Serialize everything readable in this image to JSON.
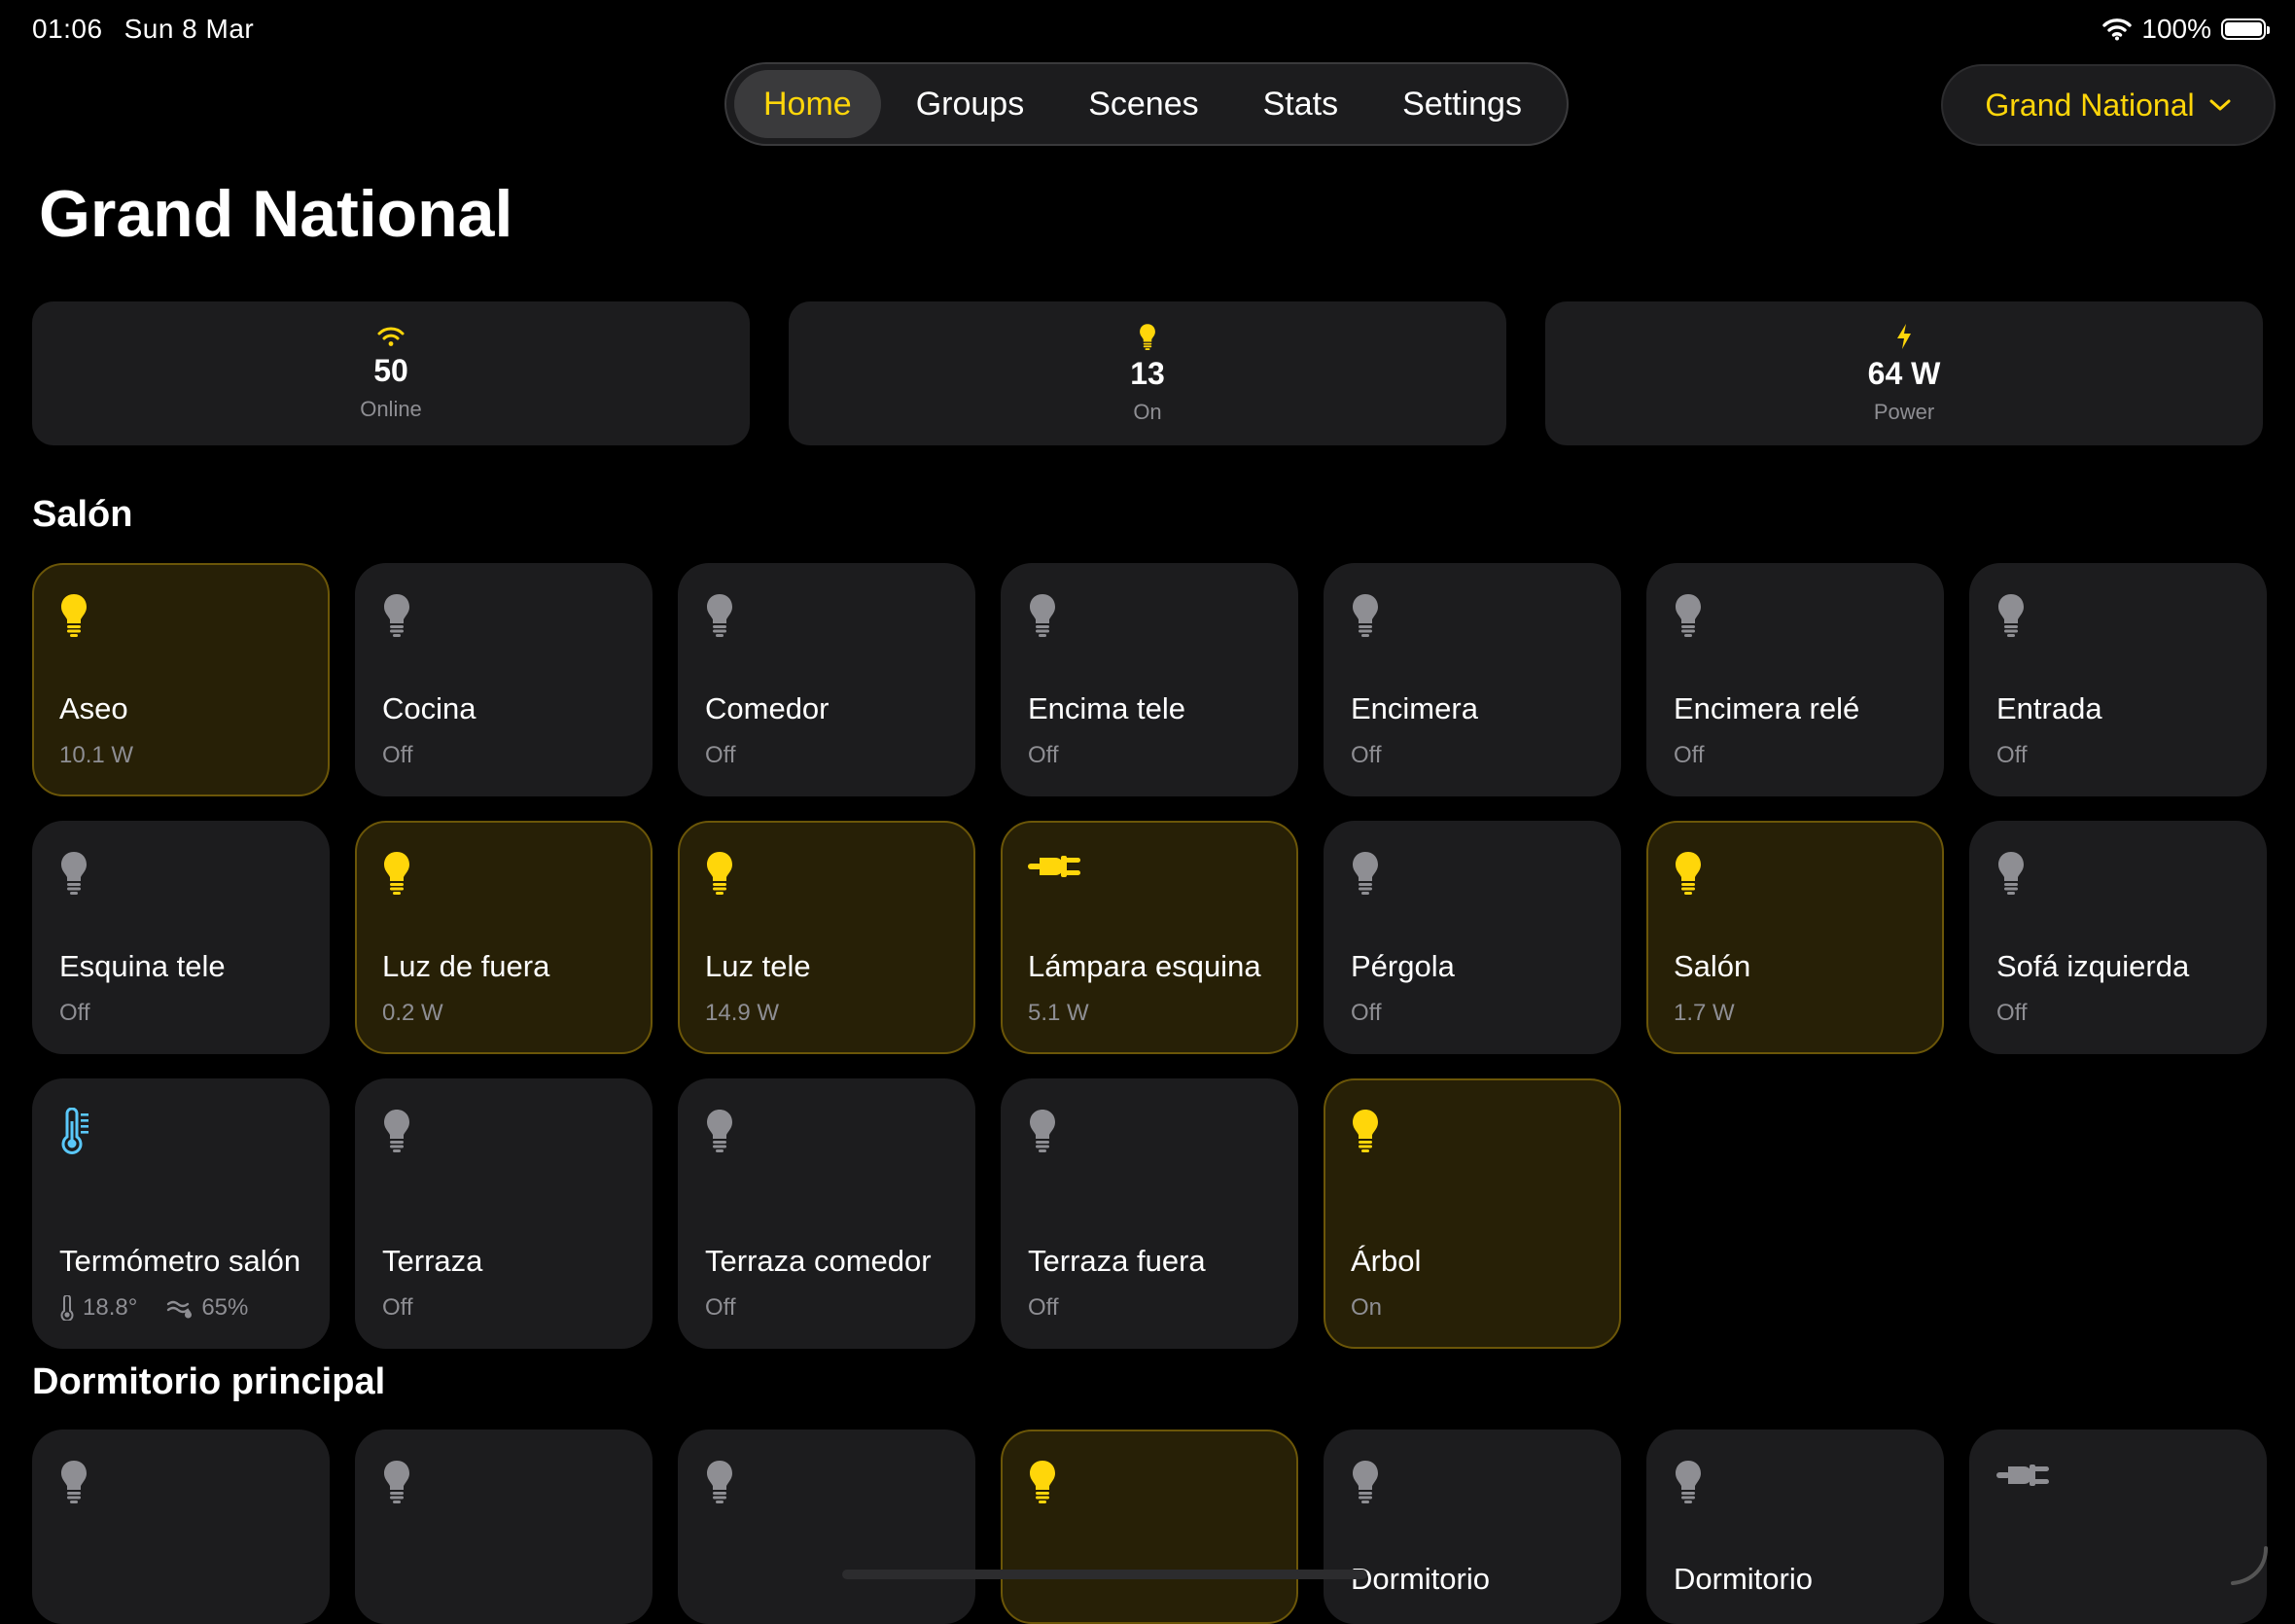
{
  "status": {
    "time": "01:06",
    "date": "Sun 8 Mar",
    "battery": "100%"
  },
  "nav": {
    "tabs": [
      {
        "label": "Home",
        "active": true
      },
      {
        "label": "Groups"
      },
      {
        "label": "Scenes"
      },
      {
        "label": "Stats"
      },
      {
        "label": "Settings"
      }
    ]
  },
  "location": {
    "label": "Grand National"
  },
  "page_title": "Grand National",
  "summary": [
    {
      "icon": "wifi-icon",
      "value": "50",
      "label": "Online"
    },
    {
      "icon": "bulb-icon",
      "value": "13",
      "label": "On"
    },
    {
      "icon": "bolt-icon",
      "value": "64 W",
      "label": "Power"
    }
  ],
  "sections": [
    {
      "title": "Salón",
      "devices": [
        {
          "name": "Aseo",
          "status": "10.1 W",
          "on": true,
          "icon": "bulb-icon"
        },
        {
          "name": "Cocina",
          "status": "Off",
          "on": false,
          "icon": "bulb-icon"
        },
        {
          "name": "Comedor",
          "status": "Off",
          "on": false,
          "icon": "bulb-icon"
        },
        {
          "name": "Encima tele",
          "status": "Off",
          "on": false,
          "icon": "bulb-icon"
        },
        {
          "name": "Encimera",
          "status": "Off",
          "on": false,
          "icon": "bulb-icon"
        },
        {
          "name": "Encimera relé",
          "status": "Off",
          "on": false,
          "icon": "bulb-icon"
        },
        {
          "name": "Entrada",
          "status": "Off",
          "on": false,
          "icon": "bulb-icon"
        },
        {
          "name": "Esquina tele",
          "status": "Off",
          "on": false,
          "icon": "bulb-icon"
        },
        {
          "name": "Luz de fuera",
          "status": "0.2 W",
          "on": true,
          "icon": "bulb-icon"
        },
        {
          "name": "Luz tele",
          "status": "14.9 W",
          "on": true,
          "icon": "bulb-icon"
        },
        {
          "name": "Lámpara esquina",
          "status": "5.1 W",
          "on": true,
          "icon": "plug-icon"
        },
        {
          "name": "Pérgola",
          "status": "Off",
          "on": false,
          "icon": "bulb-icon"
        },
        {
          "name": "Salón",
          "status": "1.7 W",
          "on": true,
          "icon": "bulb-icon"
        },
        {
          "name": "Sofá izquierda",
          "status": "Off",
          "on": false,
          "icon": "bulb-icon"
        },
        {
          "name": "Termómetro salón",
          "on": false,
          "icon": "thermometer-icon",
          "temperature": "18.8°",
          "humidity": "65%"
        },
        {
          "name": "Terraza",
          "status": "Off",
          "on": false,
          "icon": "bulb-icon"
        },
        {
          "name": "Terraza comedor",
          "status": "Off",
          "on": false,
          "icon": "bulb-icon"
        },
        {
          "name": "Terraza fuera",
          "status": "Off",
          "on": false,
          "icon": "bulb-icon"
        },
        {
          "name": "Árbol",
          "status": "On",
          "on": true,
          "icon": "bulb-icon"
        }
      ]
    },
    {
      "title": "Dormitorio principal",
      "devices": [
        {
          "name": "",
          "on": false,
          "icon": "bulb-icon"
        },
        {
          "name": "",
          "on": false,
          "icon": "bulb-icon"
        },
        {
          "name": "",
          "on": false,
          "icon": "bulb-icon"
        },
        {
          "name": "",
          "on": true,
          "icon": "bulb-icon"
        },
        {
          "name": "Dormitorio",
          "on": false,
          "icon": "bulb-icon"
        },
        {
          "name": "Dormitorio",
          "on": false,
          "icon": "bulb-icon"
        },
        {
          "name": "",
          "on": false,
          "icon": "plug-icon"
        }
      ]
    }
  ],
  "colors": {
    "accent": "#ffd60a",
    "tile": "#1c1c1e",
    "tile_on": "#272006",
    "tile_on_border": "#6b5608",
    "muted": "#8e8e93",
    "off_icon": "#8e8e93",
    "thermo": "#5ac8fa"
  }
}
